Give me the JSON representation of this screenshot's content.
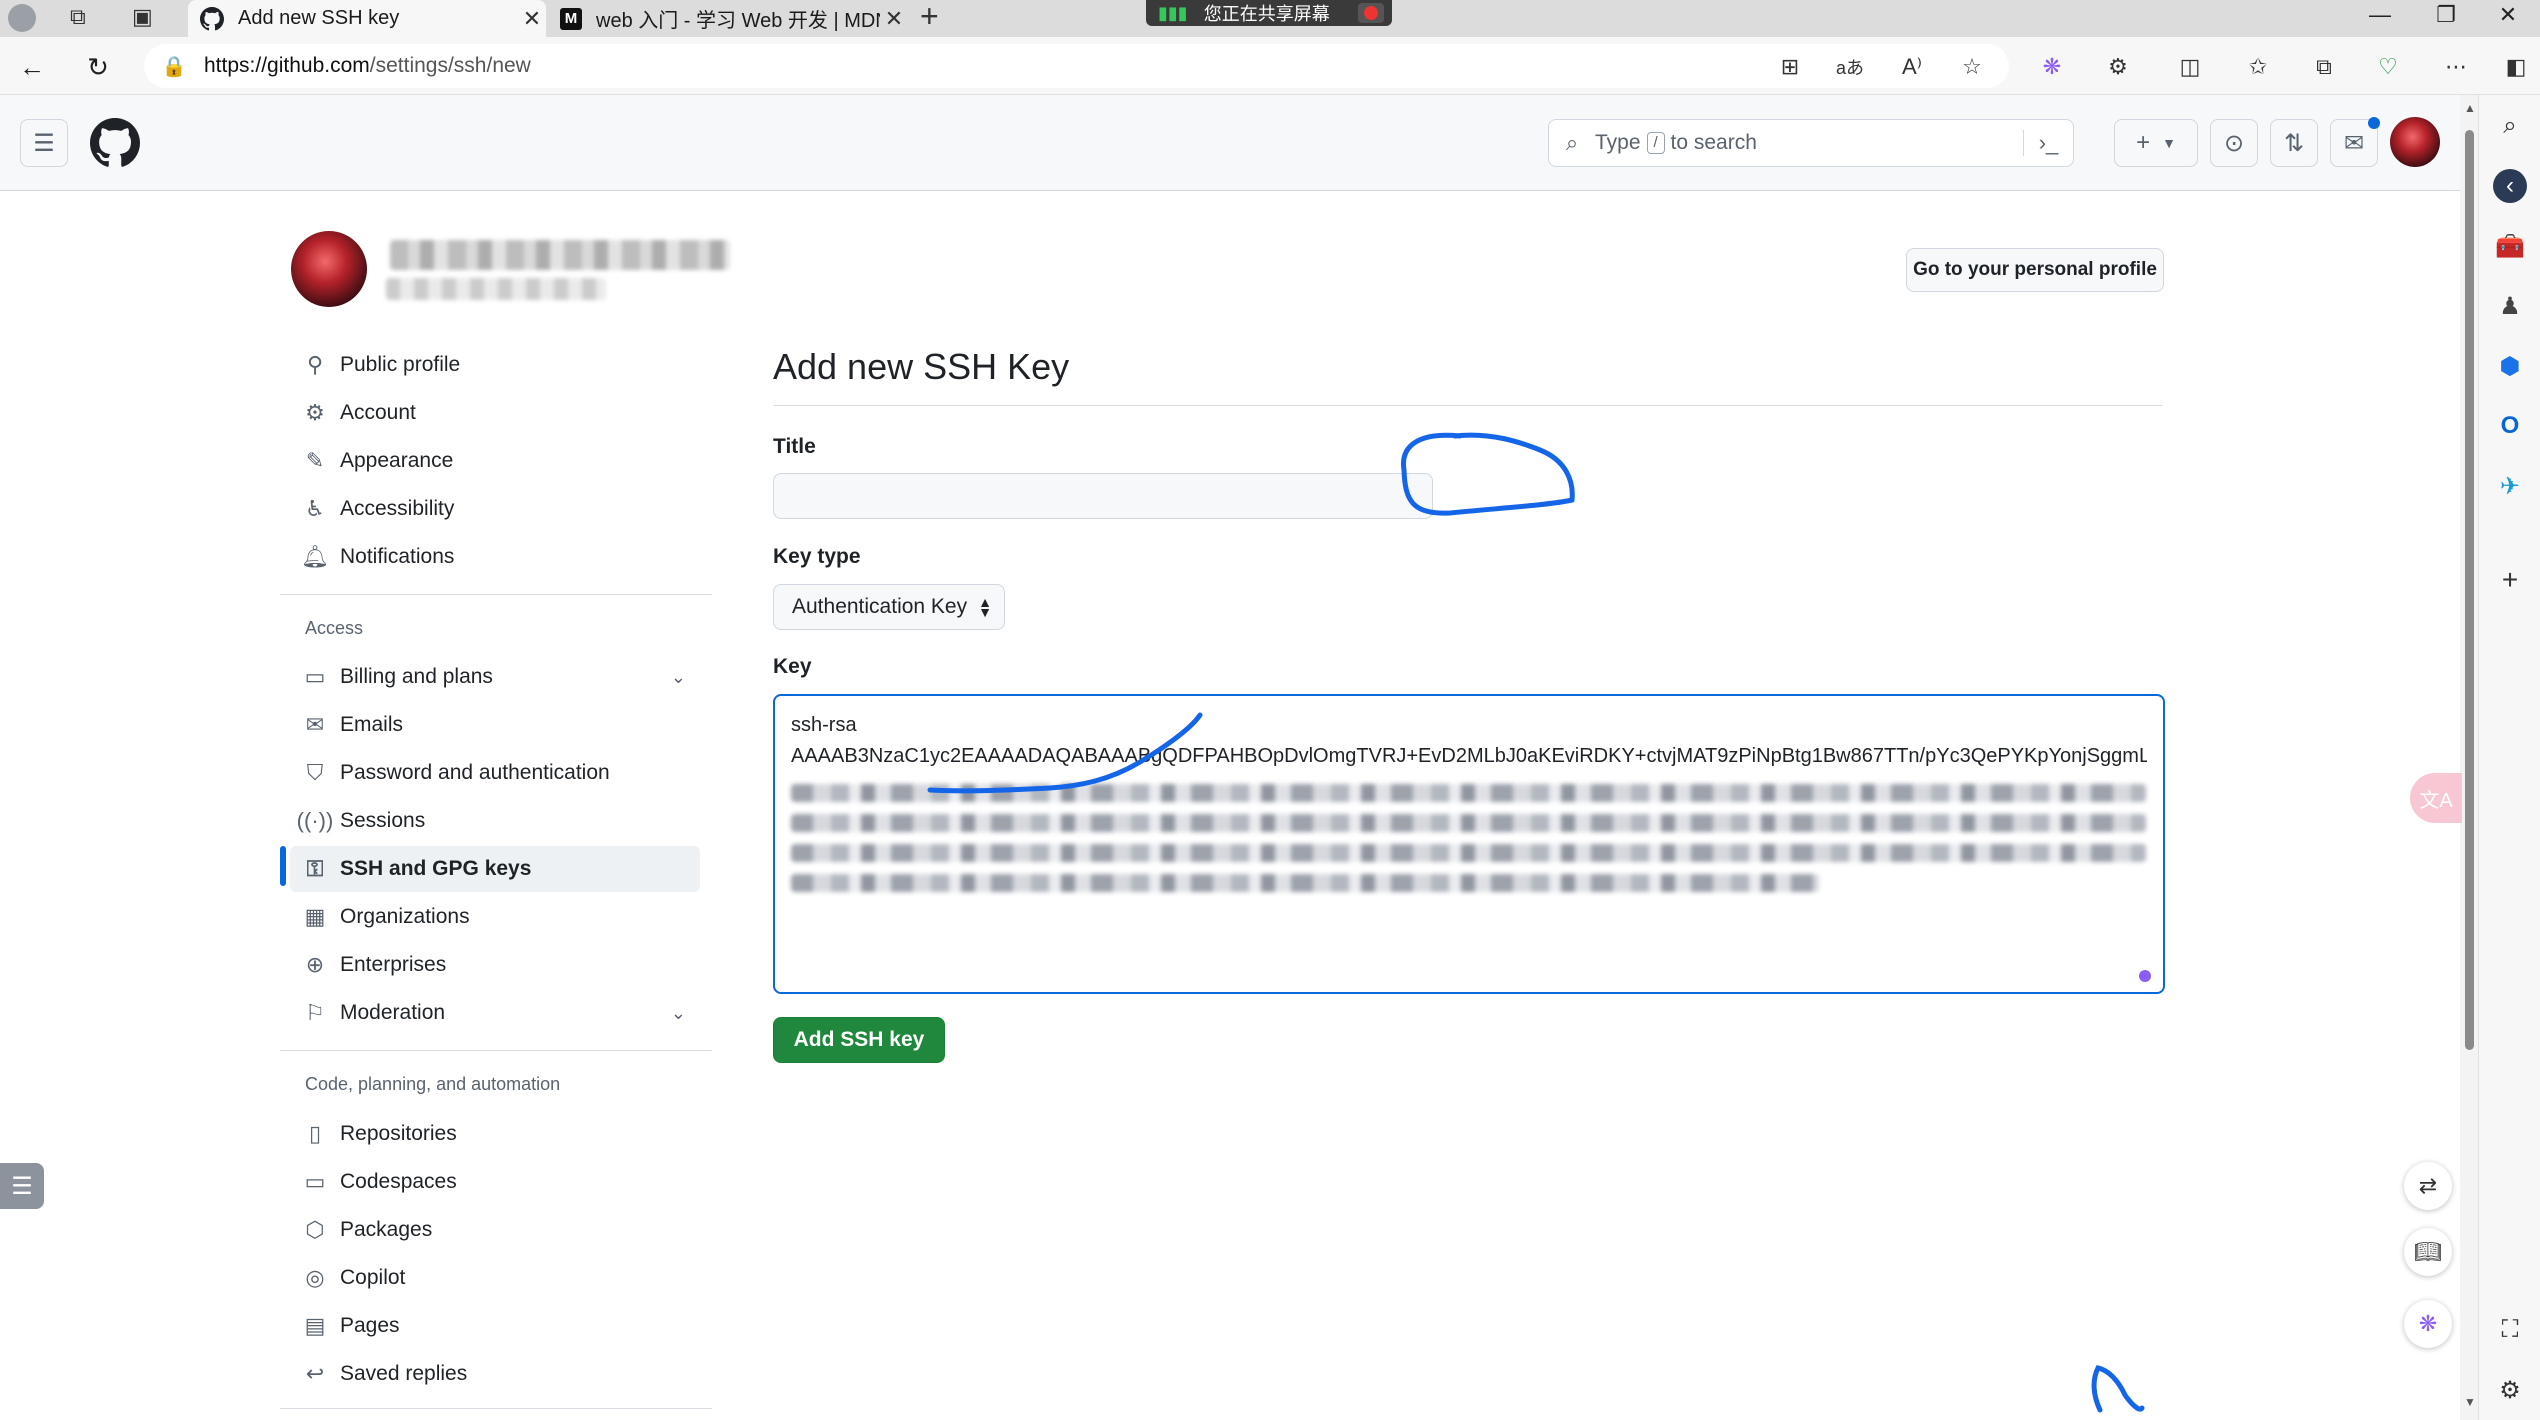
{
  "browser": {
    "tabs": [
      {
        "title": "Add new SSH key",
        "icon": "github-icon",
        "active": true
      },
      {
        "title": "web 入门 - 学习 Web 开发 | MDN",
        "icon": "mdn-icon",
        "active": false
      }
    ],
    "new_tab_symbol": "+",
    "sharing_banner": "您正在共享屏幕",
    "url_host": "https://github.com",
    "url_path": "/settings/ssh/new"
  },
  "header": {
    "search_prefix": "Type",
    "search_key": "/",
    "search_suffix": "to search",
    "create_symbol": "+"
  },
  "profile": {
    "go_to_profile_label": "Go to your personal profile"
  },
  "sidebar": {
    "items_top": [
      {
        "label": "Public profile",
        "icon": "person-icon"
      },
      {
        "label": "Account",
        "icon": "gear-icon"
      },
      {
        "label": "Appearance",
        "icon": "paintbrush-icon"
      },
      {
        "label": "Accessibility",
        "icon": "accessibility-icon"
      },
      {
        "label": "Notifications",
        "icon": "bell-icon"
      }
    ],
    "access_heading": "Access",
    "items_access": [
      {
        "label": "Billing and plans",
        "icon": "credit-card-icon",
        "expandable": true
      },
      {
        "label": "Emails",
        "icon": "mail-icon"
      },
      {
        "label": "Password and authentication",
        "icon": "shield-lock-icon"
      },
      {
        "label": "Sessions",
        "icon": "broadcast-icon"
      },
      {
        "label": "SSH and GPG keys",
        "icon": "key-icon",
        "selected": true
      },
      {
        "label": "Organizations",
        "icon": "organization-icon"
      },
      {
        "label": "Enterprises",
        "icon": "globe-icon"
      },
      {
        "label": "Moderation",
        "icon": "report-icon",
        "expandable": true
      }
    ],
    "code_heading": "Code, planning, and automation",
    "items_code": [
      {
        "label": "Repositories",
        "icon": "repo-icon"
      },
      {
        "label": "Codespaces",
        "icon": "codespaces-icon"
      },
      {
        "label": "Packages",
        "icon": "package-icon"
      },
      {
        "label": "Copilot",
        "icon": "copilot-icon"
      },
      {
        "label": "Pages",
        "icon": "browser-icon"
      },
      {
        "label": "Saved replies",
        "icon": "reply-icon"
      }
    ]
  },
  "form": {
    "page_title": "Add new SSH Key",
    "title_label": "Title",
    "title_value": "",
    "key_type_label": "Key type",
    "key_type_value": "Authentication Key",
    "key_label": "Key",
    "key_line1": "ssh-rsa",
    "key_line2": "AAAAB3NzaC1yc2EAAAADAQABAAABgQDFPAHBOpDvlOmgTVRJ+EvD2MLbJ0aKEviRDKY+ctvjMAT9zPiNpBtg1Bw867TTn/pYc3QePYKpYonjSggmL",
    "submit_label": "Add SSH key"
  },
  "colors": {
    "accent": "#0969da",
    "primary_button": "#1f883d",
    "annotation": "#1565e8"
  }
}
